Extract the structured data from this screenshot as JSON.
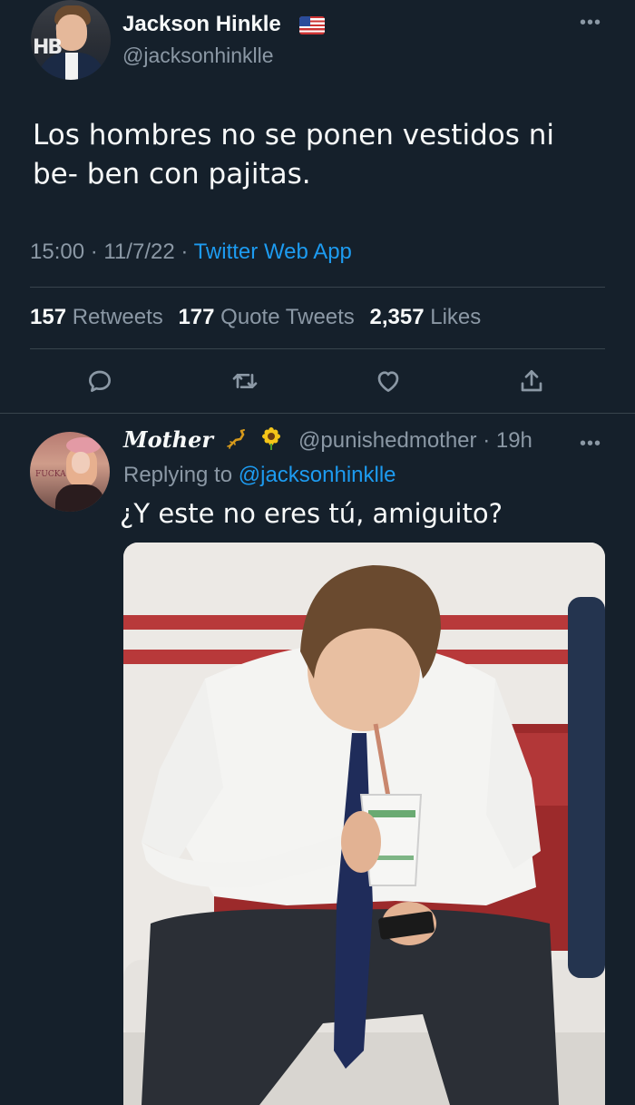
{
  "tweet": {
    "author": {
      "name": "Jackson Hinkle",
      "handle": "@jacksonhinklle",
      "flag_icon": "us-flag-icon"
    },
    "text": "Los hombres no se ponen vestidos ni be- ben con pajitas.",
    "time": "15:00",
    "date": "11/7/22",
    "source": "Twitter Web App",
    "stats": {
      "retweets_count": "157",
      "retweets_label": "Retweets",
      "quotes_count": "177",
      "quotes_label": "Quote Tweets",
      "likes_count": "2,357",
      "likes_label": "Likes"
    },
    "actions": [
      "reply-icon",
      "retweet-icon",
      "like-icon",
      "share-icon"
    ]
  },
  "reply": {
    "author": {
      "name": "Mother",
      "handle": "@punishedmother",
      "time": "19h"
    },
    "replying_label": "Replying to",
    "replying_to": "@jacksonhinklle",
    "text": "¿Y este no eres tú, amiguito?",
    "media": "photo of a man in a white shirt and navy tie sipping from a cup with a straw while looking at a phone"
  },
  "colors": {
    "background": "#15202b",
    "accent": "#1d9bf0",
    "secondary_text": "#8b98a5",
    "divider": "#38444d"
  }
}
